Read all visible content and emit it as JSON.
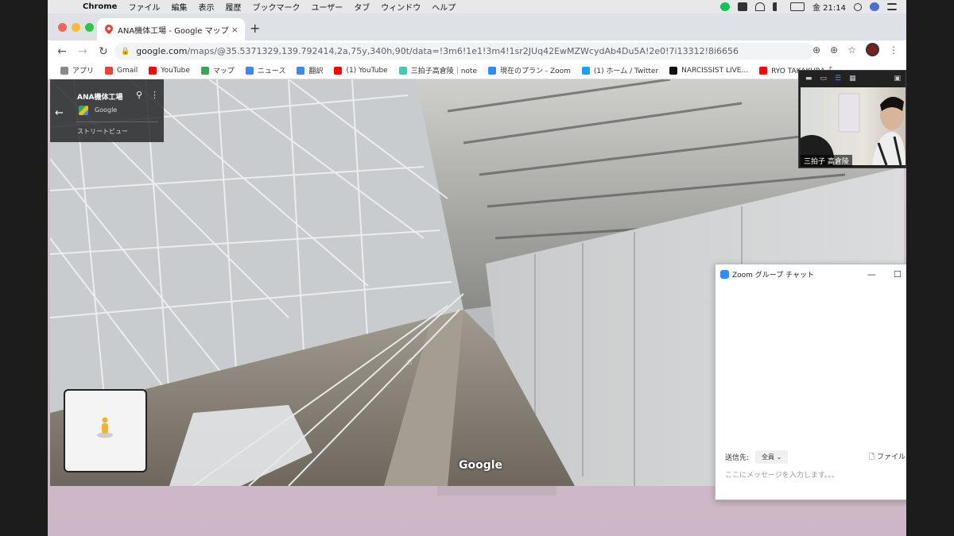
{
  "menubar": {
    "apple": "",
    "items": [
      "Chrome",
      "ファイル",
      "編集",
      "表示",
      "履歴",
      "ブックマーク",
      "ユーザー",
      "タブ",
      "ウィンドウ",
      "ヘルプ"
    ],
    "clock": "金 21:14"
  },
  "browser": {
    "tab_title": "ANA機体工場 - Google マップ",
    "tab_close": "×",
    "new_tab": "+",
    "url_host": "google.com",
    "url_rest": "/maps/@35.5371329,139.792414,2a,75y,340h,90t/data=!3m6!1e1!3m4!1sr2JUq42EwMZWcydAb4Du5A!2e0!7i13312!8i6656",
    "bookmarks": [
      {
        "label": "アプリ",
        "color": "#888"
      },
      {
        "label": "Gmail",
        "color": "#ea4335"
      },
      {
        "label": "YouTube",
        "color": "#ff0000"
      },
      {
        "label": "マップ",
        "color": "#34a853"
      },
      {
        "label": "ニュース",
        "color": "#4285f4"
      },
      {
        "label": "翻訳",
        "color": "#4285f4"
      },
      {
        "label": "(1) YouTube",
        "color": "#ff0000"
      },
      {
        "label": "三拍子高倉陵｜note",
        "color": "#41c9b4"
      },
      {
        "label": "現在のプラン - Zoom",
        "color": "#2d8cff"
      },
      {
        "label": "(1) ホーム / Twitter",
        "color": "#1da1f2"
      },
      {
        "label": "NARCISSIST LIVE...",
        "color": "#111"
      },
      {
        "label": "RYO TAKAKURA「",
        "color": "#ff0000"
      }
    ]
  },
  "streetview": {
    "place_title": "ANA機体工場",
    "provider": "Google",
    "mode": "ストリートビュー",
    "logo": "Google"
  },
  "zoom_video": {
    "participant_name": "三拍子 高倉陵"
  },
  "zoom_chat": {
    "title": "Zoom グループ チャット",
    "send_to_label": "送信先:",
    "recipient": "全員",
    "file_label": "ファイル",
    "more_label": "···",
    "input_placeholder": "ここにメッセージを入力します。。。"
  }
}
